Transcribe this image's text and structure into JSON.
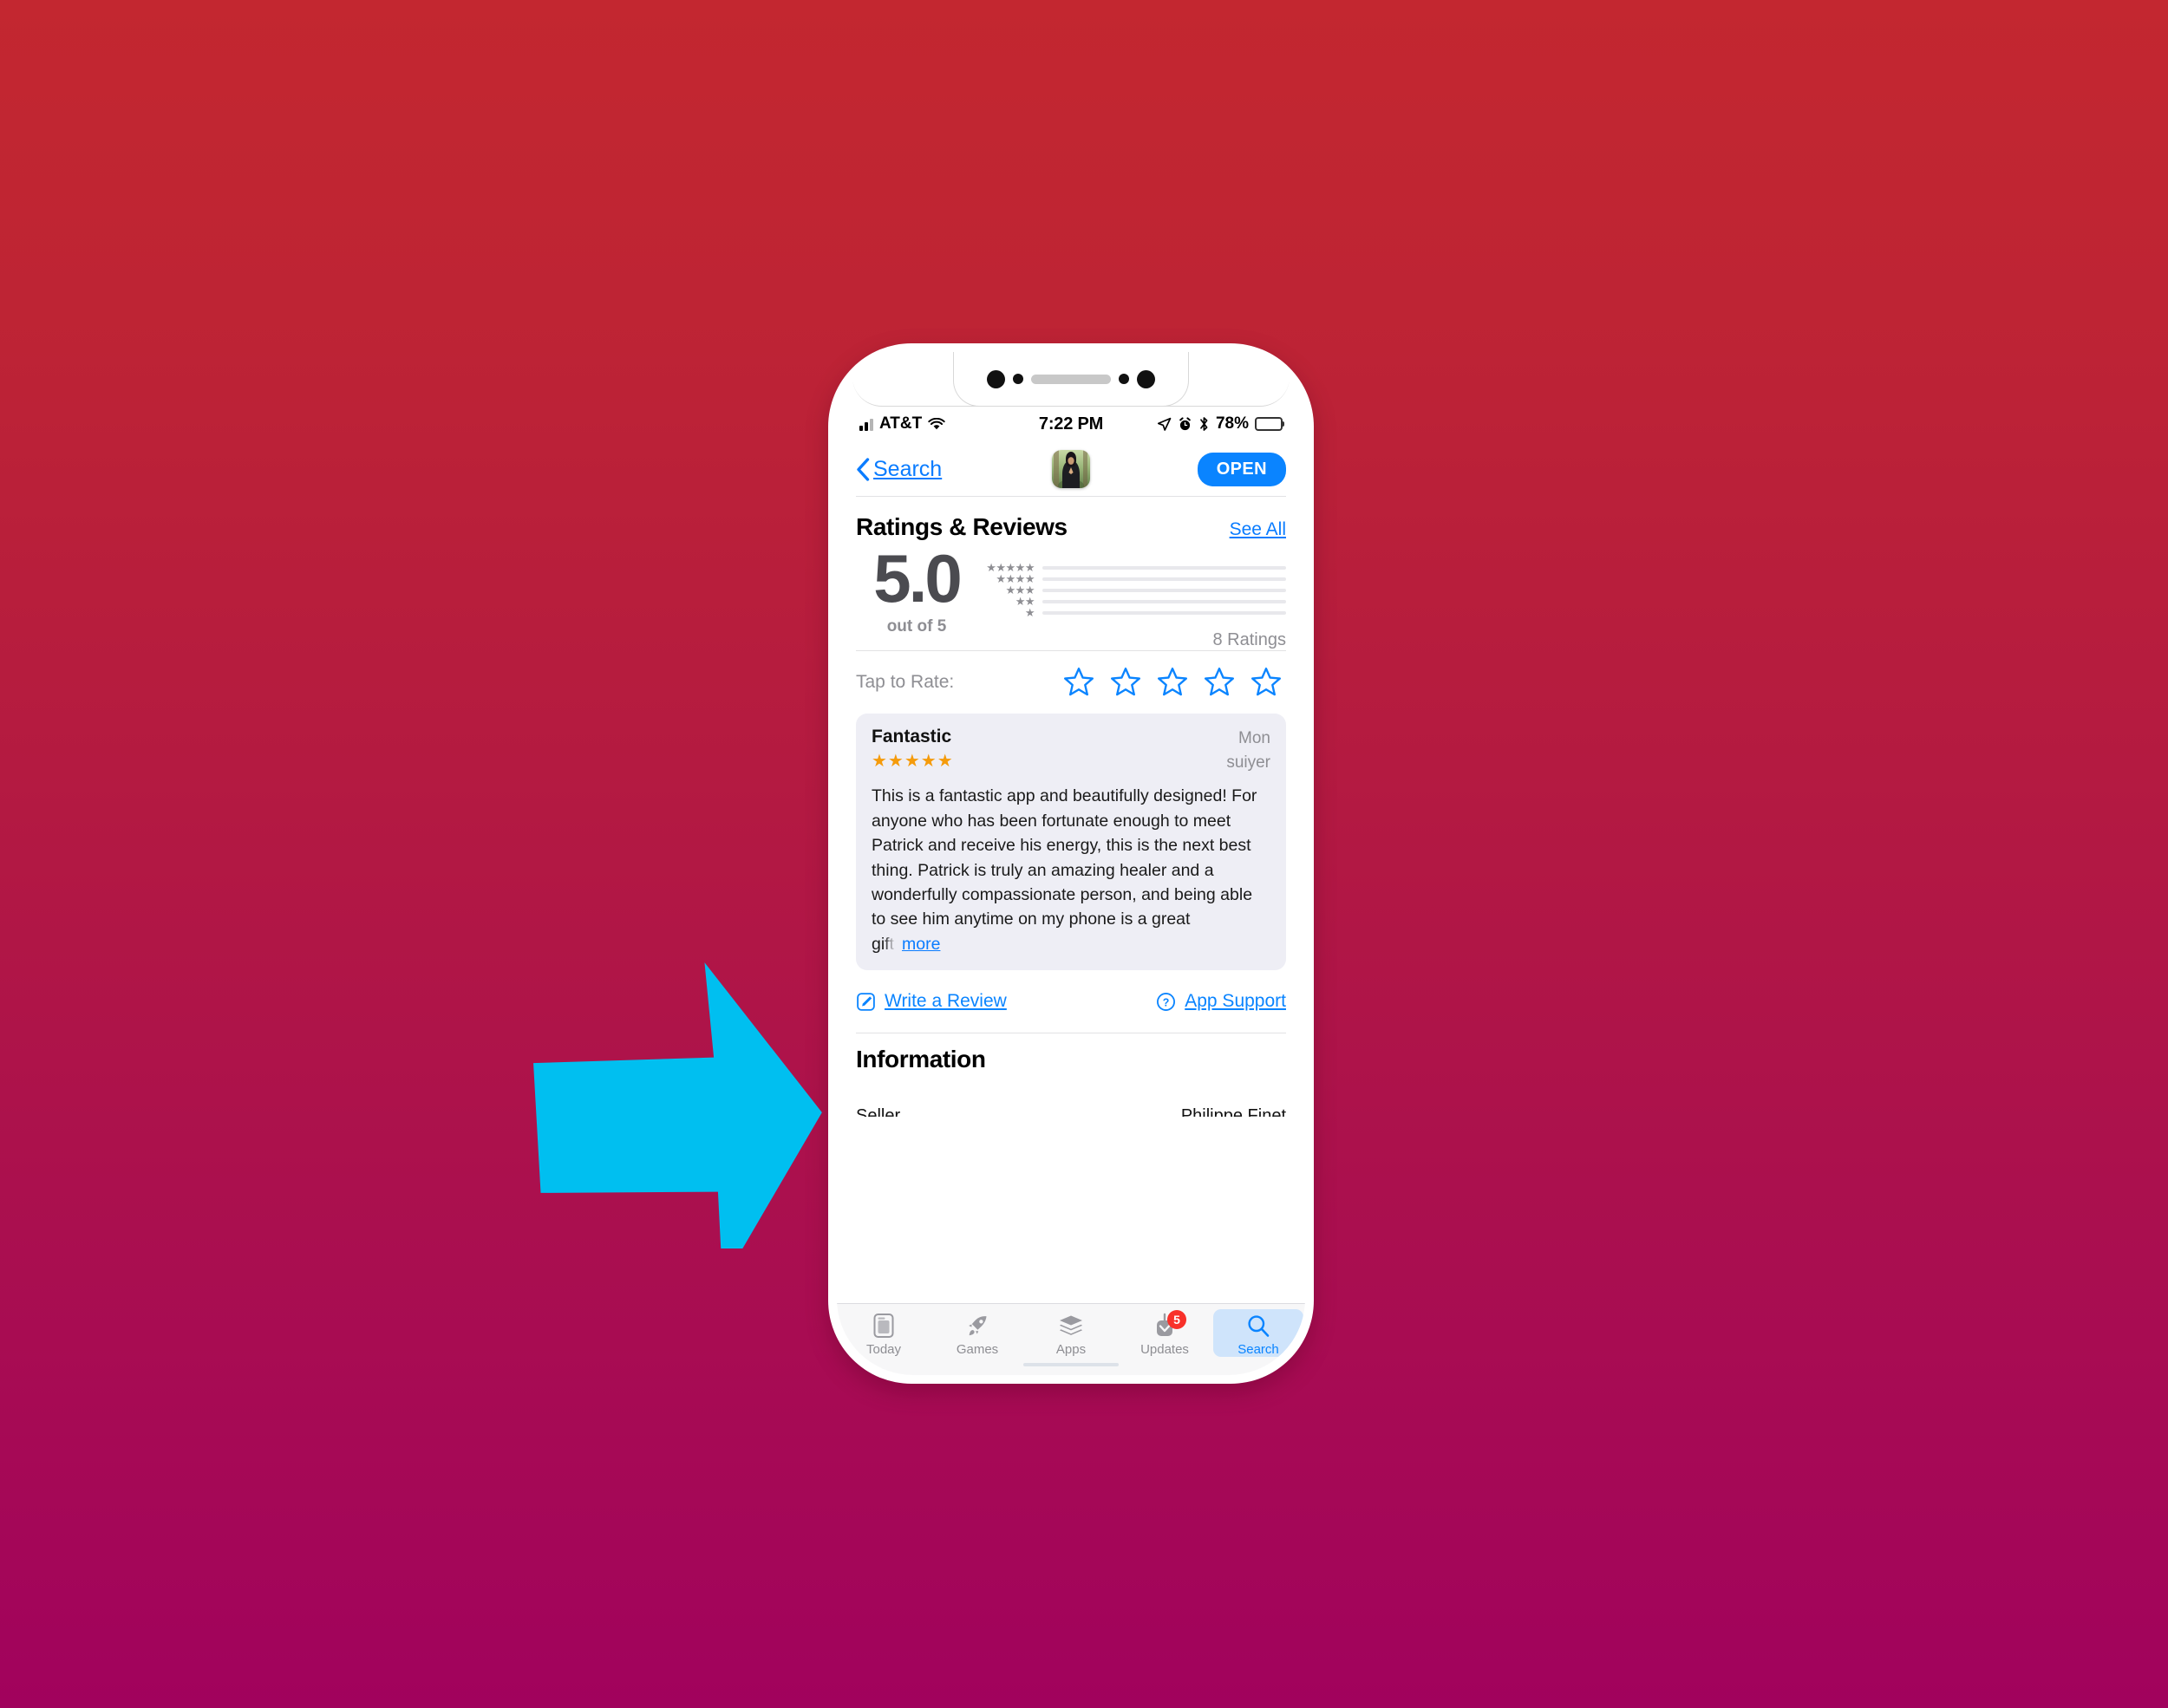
{
  "background": {
    "gradient_top": "#C32730",
    "gradient_bottom": "#A1025D"
  },
  "annotation": {
    "arrow_color": "#00BFF0",
    "arrow_points_to": "Write a Review"
  },
  "status_bar": {
    "carrier": "AT&T",
    "time": "7:22 PM",
    "battery_percent": "78%",
    "icons": [
      "cellular-signal-icon",
      "wifi-icon",
      "location-arrow-icon",
      "alarm-clock-icon",
      "bluetooth-icon",
      "battery-icon"
    ]
  },
  "nav_bar": {
    "back_label": "Search",
    "open_label": "OPEN",
    "app_icon_name": "app-icon"
  },
  "ratings": {
    "section_title": "Ratings & Reviews",
    "see_all_label": "See All",
    "score": "5.0",
    "out_of_label": "out of 5",
    "count_label": "8 Ratings",
    "histogram": [
      {
        "stars": "★★★★★",
        "percent": 100
      },
      {
        "stars": "★★★★",
        "percent": 0
      },
      {
        "stars": "★★★",
        "percent": 0
      },
      {
        "stars": "★★",
        "percent": 0
      },
      {
        "stars": "★",
        "percent": 0
      }
    ]
  },
  "tap_to_rate": {
    "label": "Tap to Rate:",
    "star_count": 5,
    "selected": 0
  },
  "review": {
    "title": "Fantastic",
    "stars": "★★★★★",
    "meta_line_1": "Mon",
    "meta_line_2": "suiyer",
    "body": "This is a fantastic app and beautifully designed! For anyone who has been fortunate enough to meet Patrick and receive his energy, this is the next best thing. Patrick is truly an amazing healer and a wonderfully compassionate person, and being able to see him anytime on my phone is a great",
    "body_tail_faded": "gift",
    "more_label": "more"
  },
  "actions": {
    "write_review_label": "Write a Review",
    "write_review_icon": "compose-icon",
    "app_support_label": "App Support",
    "app_support_icon": "question-circle-icon"
  },
  "information": {
    "section_title": "Information",
    "row_label": "Seller",
    "row_value": "Philippe Finet"
  },
  "tab_bar": {
    "items": [
      {
        "label": "Today",
        "icon": "today-card-icon",
        "active": false,
        "badge": ""
      },
      {
        "label": "Games",
        "icon": "rocket-icon",
        "active": false,
        "badge": ""
      },
      {
        "label": "Apps",
        "icon": "stack-layers-icon",
        "active": false,
        "badge": ""
      },
      {
        "label": "Updates",
        "icon": "download-arrow-icon",
        "active": false,
        "badge": "5"
      },
      {
        "label": "Search",
        "icon": "magnifier-icon",
        "active": true,
        "badge": ""
      }
    ]
  }
}
